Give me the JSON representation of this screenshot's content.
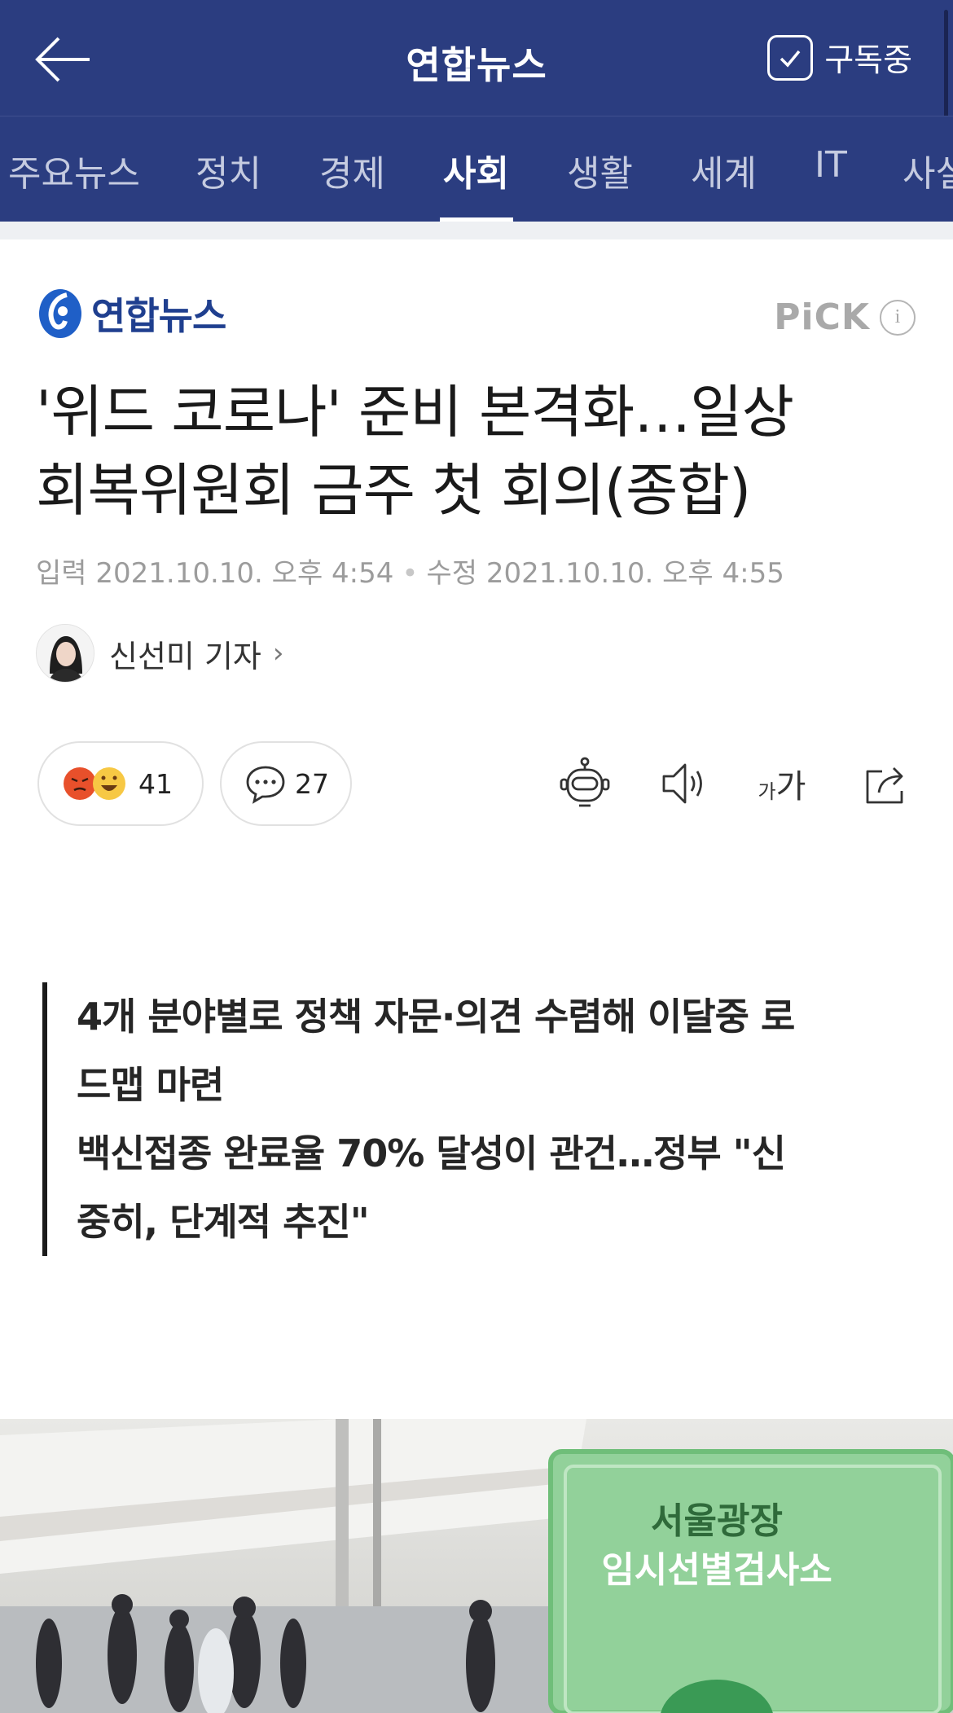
{
  "header": {
    "title": "연합뉴스",
    "back_icon": "arrow-left-icon",
    "subscribe_label": "구독중",
    "subscribe_icon": "checkbox-checked-icon",
    "background": "#2b3d80"
  },
  "tabs": [
    {
      "label": "주요뉴스",
      "active": false
    },
    {
      "label": "정치",
      "active": false
    },
    {
      "label": "경제",
      "active": false
    },
    {
      "label": "사회",
      "active": true
    },
    {
      "label": "생활",
      "active": false
    },
    {
      "label": "세계",
      "active": false
    },
    {
      "label": "IT",
      "active": false
    },
    {
      "label": "사설",
      "active": false
    }
  ],
  "article": {
    "press_name": "연합뉴스",
    "pick_label": "PiCK",
    "pick_info": "i",
    "headline_line1": "'위드 코로나' 준비 본격화…일상",
    "headline_line2": "회복위원회 금주 첫 회의(종합)",
    "input_label": "입력",
    "input_date": "2021.10.10. 오후 4:54",
    "modified_label": "수정",
    "modified_date": "2021.10.10. 오후 4:55",
    "author_name": "신선미 기자",
    "reaction_count": "41",
    "comment_count": "27",
    "font_size_label_small": "가",
    "font_size_label_large": "가",
    "summary_lines": [
      "4개 분야별로 정책 자문·의견 수렴해 이달중 로",
      "드맵 마련",
      "백신접종 완료율 70% 달성이 관건…정부 \"신",
      "중히, 단계적 추진\""
    ],
    "photo_sign_line1": "서울광장",
    "photo_sign_line2": "임시선별검사소"
  },
  "colors": {
    "accent": "#2b3d80",
    "press_blue": "#1f3f8f",
    "sign_green": "#92d19a"
  }
}
